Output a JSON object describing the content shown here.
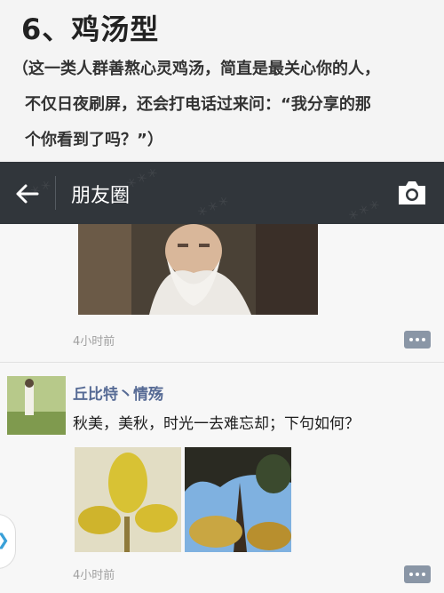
{
  "caption": {
    "title": "6、鸡汤型",
    "line1": "（这一类人群善熬心灵鸡汤，简直是最关心你的人，",
    "line2": "不仅日夜刷屏，还会打电话过来问：“我分享的那",
    "line3": "个你看到了吗？”）"
  },
  "appbar": {
    "title": "朋友圈",
    "back_icon": "arrow-left-icon",
    "camera_icon": "camera-icon"
  },
  "feed": {
    "posts": [
      {
        "time": "4小时前"
      },
      {
        "author": "丘比特丶情殇",
        "text": "秋美，美秋，时光一去难忘却；下句如何？",
        "time": "4小时前"
      }
    ]
  },
  "colors": {
    "appbar": "#31363b",
    "username": "#576b95",
    "comment_button": "#8a96a6"
  }
}
